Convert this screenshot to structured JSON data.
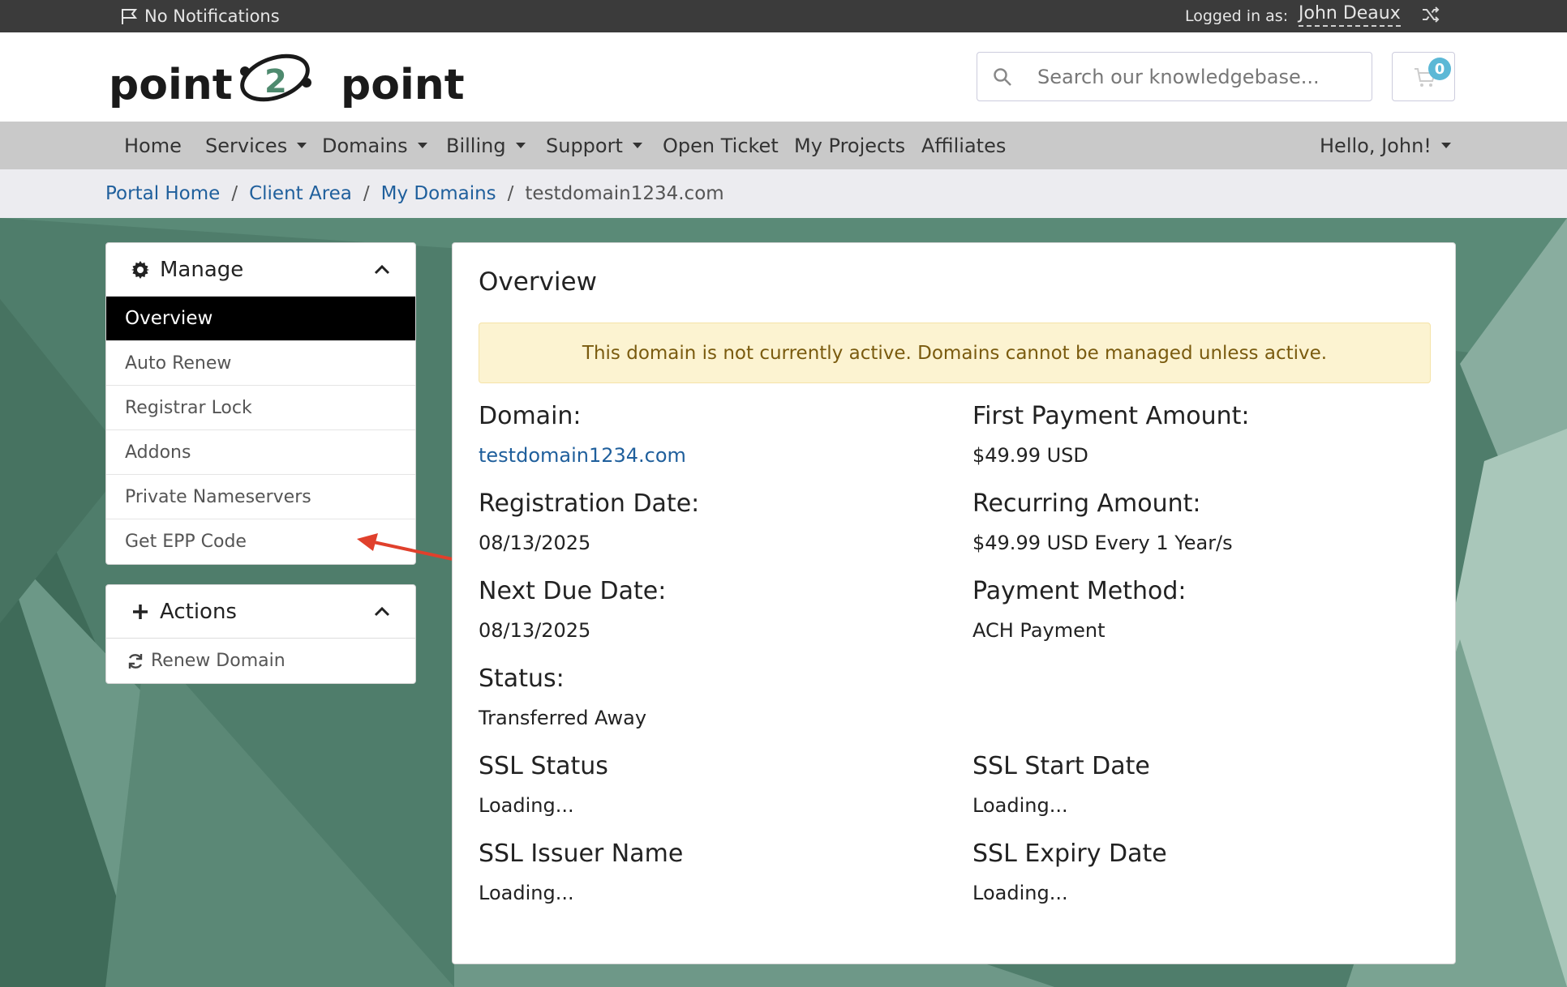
{
  "topbar": {
    "notifications": "No Notifications",
    "logged_in_label": "Logged in as:",
    "user_name": "John Deaux"
  },
  "header": {
    "search_placeholder": "Search our knowledgebase...",
    "cart_count": "0"
  },
  "nav": {
    "items": [
      {
        "label": "Home",
        "dropdown": false
      },
      {
        "label": "Services",
        "dropdown": true
      },
      {
        "label": "Domains",
        "dropdown": true
      },
      {
        "label": "Billing",
        "dropdown": true
      },
      {
        "label": "Support",
        "dropdown": true
      },
      {
        "label": "Open Ticket",
        "dropdown": false
      },
      {
        "label": "My Projects",
        "dropdown": false
      },
      {
        "label": "Affiliates",
        "dropdown": false
      }
    ],
    "greeting": "Hello, John!"
  },
  "breadcrumb": {
    "items": [
      "Portal Home",
      "Client Area",
      "My Domains"
    ],
    "current": "testdomain1234.com"
  },
  "sidebar": {
    "manage": {
      "title": "Manage",
      "items": [
        "Overview",
        "Auto Renew",
        "Registrar Lock",
        "Addons",
        "Private Nameservers",
        "Get EPP Code"
      ],
      "active": "Overview"
    },
    "actions": {
      "title": "Actions",
      "items": [
        "Renew Domain"
      ]
    }
  },
  "main": {
    "title": "Overview",
    "alert": "This domain is not currently active. Domains cannot be managed unless active.",
    "fields": {
      "domain": {
        "label": "Domain:",
        "value": "testdomain1234.com"
      },
      "first_payment": {
        "label": "First Payment Amount:",
        "value": "$49.99 USD"
      },
      "registration_date": {
        "label": "Registration Date:",
        "value": "08/13/2025"
      },
      "recurring_amount": {
        "label": "Recurring Amount:",
        "value": "$49.99 USD Every 1 Year/s"
      },
      "next_due_date": {
        "label": "Next Due Date:",
        "value": "08/13/2025"
      },
      "payment_method": {
        "label": "Payment Method:",
        "value": "ACH Payment"
      },
      "status": {
        "label": "Status:",
        "value": "Transferred Away"
      },
      "ssl_status": {
        "label": "SSL Status",
        "value": "Loading..."
      },
      "ssl_start_date": {
        "label": "SSL Start Date",
        "value": "Loading..."
      },
      "ssl_issuer_name": {
        "label": "SSL Issuer Name",
        "value": "Loading..."
      },
      "ssl_expiry_date": {
        "label": "SSL Expiry Date",
        "value": "Loading..."
      }
    }
  },
  "colors": {
    "link": "#1f5f9c",
    "alert_bg": "#fcf3d1",
    "alert_text": "#7a5b0f",
    "annotation_arrow": "#e0402c",
    "cart_badge": "#5cb8d6"
  }
}
